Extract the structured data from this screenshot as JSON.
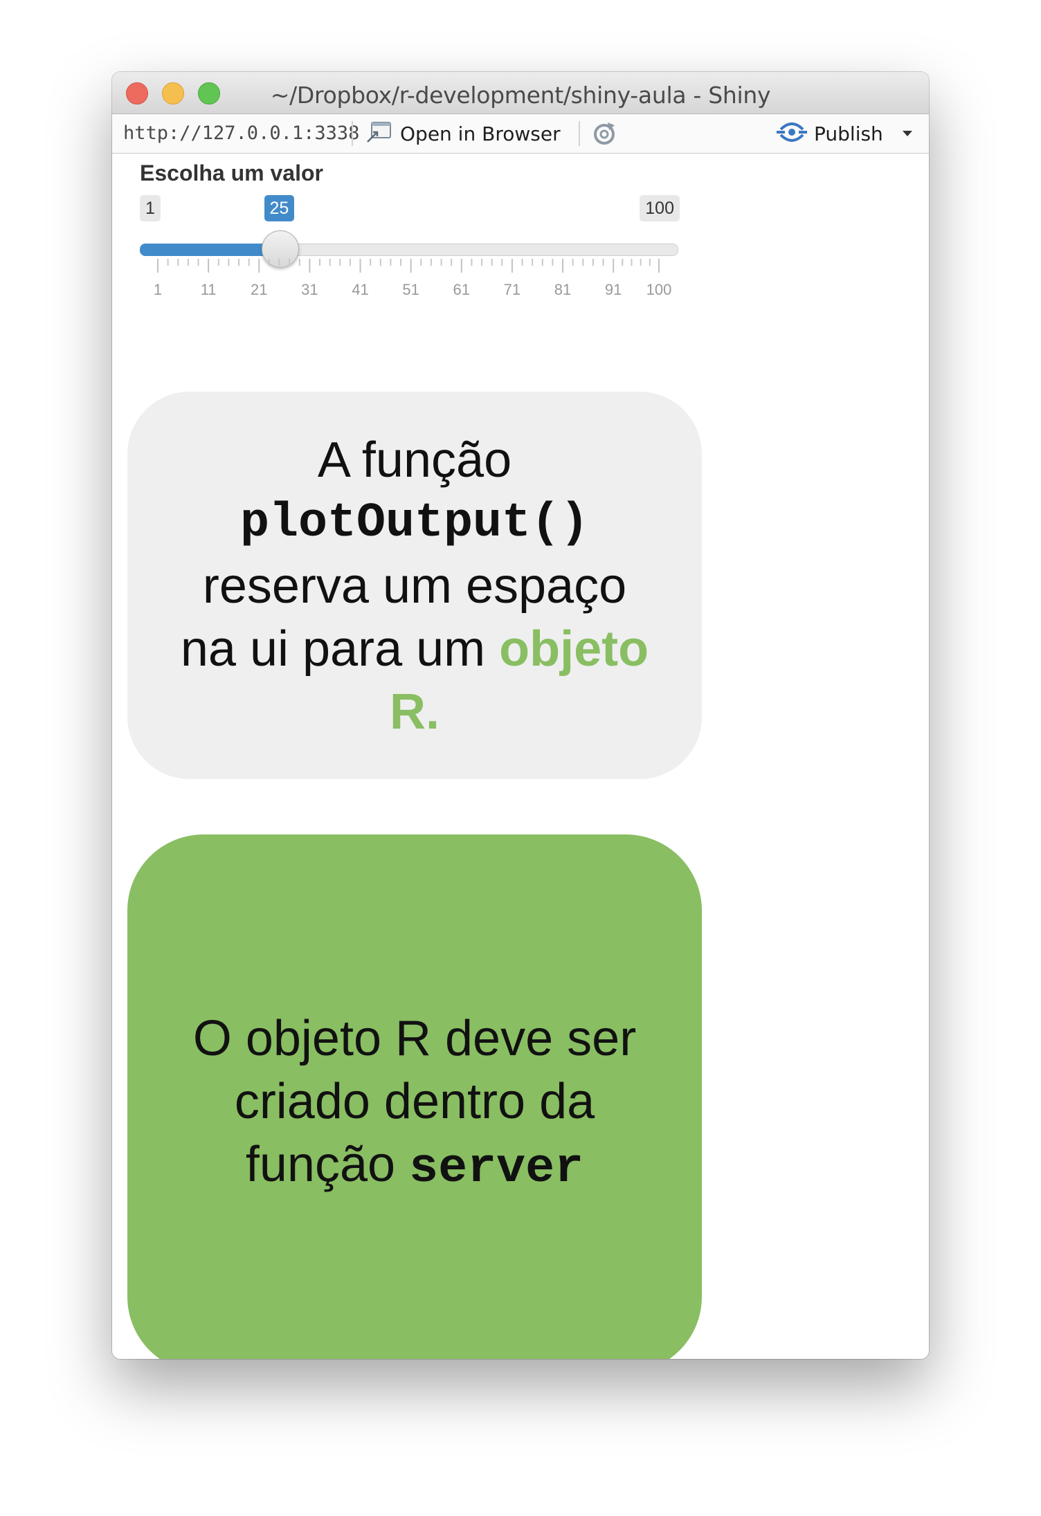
{
  "window": {
    "title": "~/Dropbox/r-development/shiny-aula - Shiny"
  },
  "toolbar": {
    "url": "http://127.0.0.1:3338",
    "open_in_browser_label": "Open in Browser",
    "publish_label": "Publish"
  },
  "slider": {
    "label": "Escolha um valor",
    "min": 1,
    "max": 100,
    "value": 25,
    "min_text": "1",
    "max_text": "100",
    "value_text": "25",
    "tick_labels": [
      "1",
      "11",
      "21",
      "31",
      "41",
      "51",
      "61",
      "71",
      "81",
      "91",
      "100"
    ]
  },
  "card_gray": {
    "line1": "A função",
    "code": "plotOutput()",
    "line3": "reserva um espaço",
    "line4_prefix": "na ui para um ",
    "highlight_part1": "objeto",
    "highlight_part2": "R."
  },
  "card_green": {
    "line1": "O objeto R deve ser",
    "line2": "criado dentro da",
    "line3_prefix": "função ",
    "code": "server"
  },
  "colors": {
    "slider_accent": "#428bca",
    "green_accent": "#89be62",
    "card_gray": "#efefef"
  }
}
